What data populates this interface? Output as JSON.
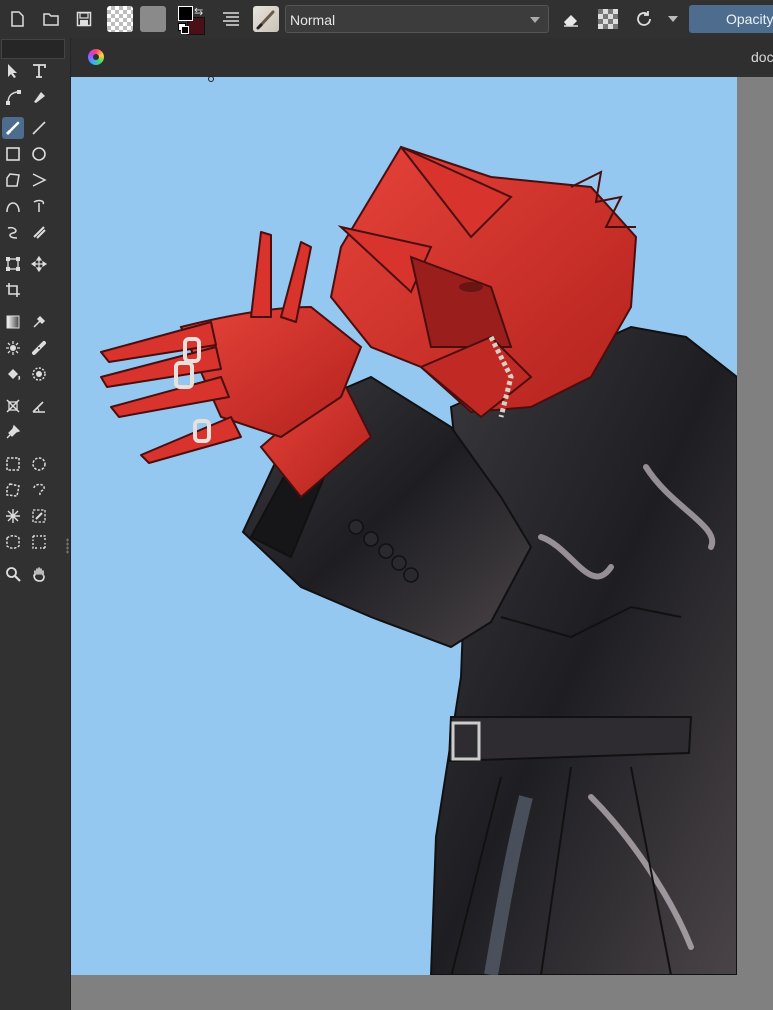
{
  "toolbar": {
    "blend_mode": "Normal",
    "opacity_label": "Opacity",
    "icons": [
      "new-document-icon",
      "open-document-icon",
      "save-icon",
      "gradient-swatch",
      "pattern-swatch",
      "fg-bg-color",
      "layers-list-icon",
      "brush-preset",
      "eraser-icon",
      "alpha-lock-icon",
      "reload-icon",
      "mirror-dropdown-icon"
    ]
  },
  "document": {
    "title": "doc"
  },
  "toolbox": {
    "tools": [
      "select-shapes",
      "text",
      "edit-shapes",
      "calligraphy",
      "freehand-brush",
      "line",
      "rectangle",
      "ellipse",
      "polygon",
      "polyline",
      "bezier-curve",
      "freehand-path",
      "dynamic-brush",
      "multibrush",
      "transform",
      "move",
      "crop",
      "gradient",
      "color-sampler",
      "colorize-mask",
      "smart-patch",
      "fill",
      "enclose-fill",
      "assistant",
      "measure",
      "reference-images",
      "rect-select",
      "ellipse-select",
      "polygon-select",
      "freehand-select",
      "contiguous-select",
      "similar-select",
      "bezier-select",
      "magnetic-select",
      "zoom",
      "pan"
    ],
    "active_tool": "freehand-brush"
  },
  "colors": {
    "canvas_background": "#94c8f0",
    "accent": "#4e6d8e",
    "foreground": "#000000",
    "background_color": "#4a1018",
    "figure_skin": "#d8332c",
    "coat": "#2a2a2e"
  }
}
